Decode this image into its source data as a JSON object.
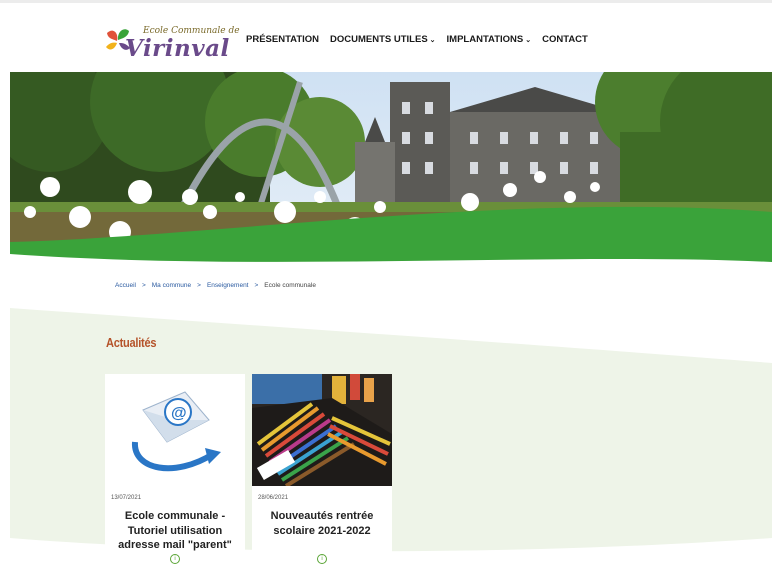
{
  "logo": {
    "line1": "Ecole Communale de",
    "line2": "Virinval",
    "icon": "butterfly-logo"
  },
  "nav": [
    {
      "label": "PRÉSENTATION",
      "dropdown": false
    },
    {
      "label": "DOCUMENTS UTILES",
      "dropdown": true
    },
    {
      "label": "IMPLANTATIONS",
      "dropdown": true
    },
    {
      "label": "CONTACT",
      "dropdown": false
    }
  ],
  "chevron": "⌄",
  "breadcrumb": {
    "items": [
      "Accueil",
      "Ma commune",
      "Enseignement"
    ],
    "current": "Ecole communale",
    "separator": ">"
  },
  "section": {
    "title": "Actualités"
  },
  "cards": [
    {
      "date": "13/07/2021",
      "title": "Ecole communale - Tutoriel utilisation adresse mail \"parent\"",
      "more_icon": "i"
    },
    {
      "date": "28/06/2021",
      "title": "Nouveautés rentrée scolaire 2021-2022",
      "more_icon": "i"
    }
  ],
  "colors": {
    "accent_green": "#3aa33a",
    "title_red": "#b5532a",
    "band_green": "#eef4e8"
  }
}
